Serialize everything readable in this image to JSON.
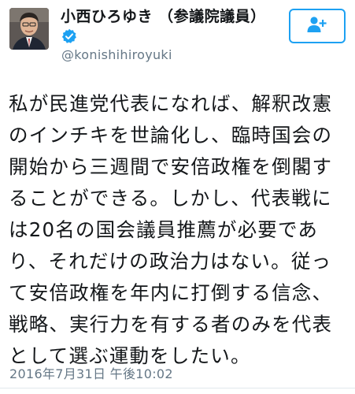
{
  "profile": {
    "display_name": "小西ひろゆき （参議院議員）",
    "handle": "@konishihiroyuki",
    "verified": true
  },
  "follow_button": {
    "icon": "add-user-icon",
    "color": "#1da1f2"
  },
  "tweet": {
    "text": "私が民進党代表になれば、解釈改憲\nのインチキを世論化し、臨時国会の\n開始から三週間で安倍政権を倒閣す\nることができる。しかし、代表戦に\nは20名の国会議員推薦が必要であ\nり、それだけの政治力はない。従っ\nて安倍政権を年内に打倒する信念、\n戦略、実行力を有する者のみを代表\nとして選ぶ運動をしたい。",
    "timestamp": "2016年7月31日 午後10:02"
  },
  "colors": {
    "accent": "#1da1f2",
    "text": "#14171a",
    "secondary": "#657786"
  }
}
